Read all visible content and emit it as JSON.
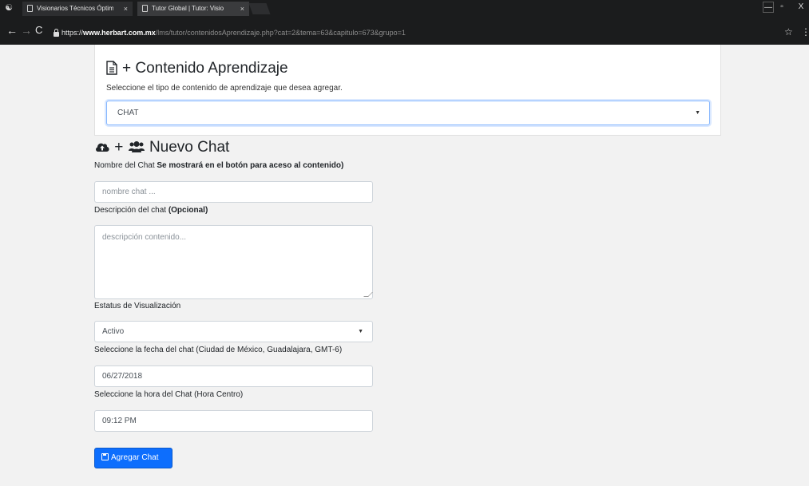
{
  "browser": {
    "tabs": [
      {
        "title": "Visionarios Técnicos Óptim",
        "close": "×",
        "active": false
      },
      {
        "title": "Tutor Global | Tutor: Visio",
        "close": "×",
        "active": true
      }
    ],
    "window_controls": {
      "minimize": "—",
      "maximize": "▫",
      "close": "X"
    },
    "nav": {
      "back": "←",
      "forward": "→",
      "reload": "C"
    },
    "url": {
      "protocol": "https://",
      "host": "www.herbart.com.mx",
      "path": "/lms/tutor/contenidosAprendizaje.php?cat=2&tema=63&capitulo=673&grupo=1"
    },
    "bookmark_icon": "star-icon",
    "menu_icon": "kebab-menu-icon"
  },
  "content_selector": {
    "title": "+ Contenido Aprendizaje",
    "icon": "document-icon",
    "subtitle": "Seleccione el tipo de contenido de aprendizaje que desea agregar.",
    "selected": "CHAT"
  },
  "new_chat": {
    "title_plus": "+",
    "title_text": "Nuevo Chat",
    "icons": [
      "cloud-upload-icon",
      "users-icon"
    ],
    "name_label": "Nombre del Chat",
    "name_label_bold": "Se mostrará en el botón para aceso al contenido)",
    "name_placeholder": "nombre chat ...",
    "desc_label": "Descripción del chat",
    "desc_label_bold": "(Opcional)",
    "desc_placeholder": "descripción contenido...",
    "status_label": "Estatus de Visualización",
    "status_value": "Activo",
    "date_label": "Seleccione la fecha del chat (Ciudad de México, Guadalajara, GMT-6)",
    "date_value": "06/27/2018",
    "time_label": "Seleccione la hora del Chat (Hora Centro)",
    "time_value": "09:12 PM",
    "submit_label": "Agregar Chat"
  },
  "colors": {
    "primary": "#0d6efd",
    "chrome_bg": "#1b1c1d",
    "page_bg": "#f2f2f2"
  }
}
